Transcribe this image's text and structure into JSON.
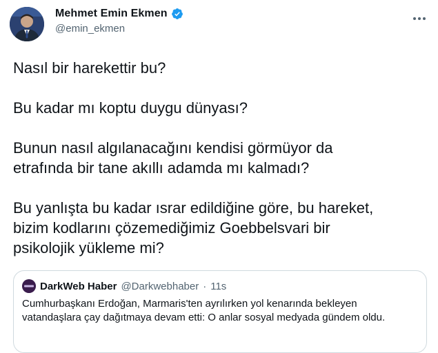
{
  "author": {
    "name": "Mehmet Emin Ekmen",
    "handle": "@emin_ekmen",
    "verified": true
  },
  "tweet": {
    "paragraphs": [
      "Nasıl bir harekettir bu?",
      "Bu kadar mı koptu duygu dünyası?",
      "Bunun nasıl algılanacağını kendisi görmüyor da\netrafında bir tane akıllı adamda mı kalmadı?",
      "Bu yanlışta bu kadar ısrar edildiğine göre, bu hareket,\nbizim kodlarını çözemediğimiz Goebbelsvari bir\npsikolojik yükleme mi?"
    ]
  },
  "quoted": {
    "name": "DarkWeb Haber",
    "handle": "@Darkwebhaber",
    "separator": "·",
    "time": "11s",
    "text": "Cumhurbaşkanı Erdoğan, Marmaris'ten ayrılırken yol kenarında bekleyen vatandaşlara çay dağıtmaya devam etti: O anlar sosyal medyada gündem oldu."
  },
  "icons": {
    "more": "more-horizontal-icon",
    "verified": "verified-badge-icon"
  },
  "colors": {
    "verified": "#1d9bf0",
    "secondary_text": "#536471",
    "border": "#cfd9de"
  }
}
